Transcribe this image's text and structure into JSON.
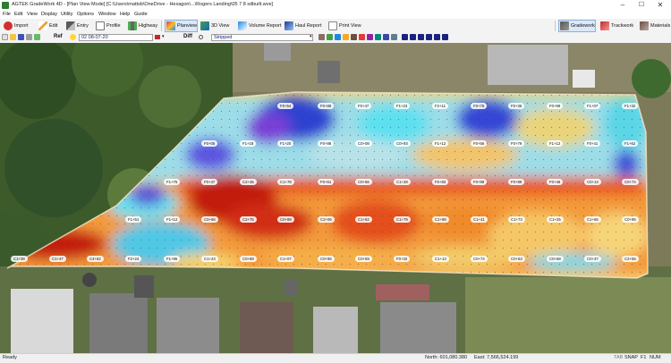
{
  "window": {
    "title": "AGTEK GradeWork 4D - [Plan View Mode] [C:\\Users\\mattsb\\OneDrive - Hexagon\\...\\Rogers Landing\\05 7 8 sdbuilt.wve]",
    "controls": [
      "–",
      "☐",
      "✕"
    ]
  },
  "menu": [
    "File",
    "Edit",
    "View",
    "Display",
    "Utility",
    "Options",
    "Window",
    "Help",
    "Guide"
  ],
  "toolbar": {
    "import": "Import",
    "edit": "Edit",
    "entry": "Entry",
    "profile": "Profile",
    "highway": "Highway",
    "planview": "Planview",
    "view3d": "3D View",
    "volume_report": "Volume Report",
    "haul_report": "Haul Report",
    "print_view": "Print View",
    "gradework": "Gradework",
    "trackwork": "Trackwork",
    "materials": "Materials"
  },
  "refbar": {
    "ref_label": "Ref",
    "ref_value": "02 08-07-20",
    "diff_label": "Diff",
    "diff_value": "Stripped"
  },
  "stations": {
    "row1": [
      "F0+54",
      "F0+88",
      "F0+47",
      "F1+23",
      "F2+11",
      "F0+75",
      "F0+36",
      "F0+99",
      "F1+07",
      "F1+32"
    ],
    "row2": [
      "F0+05",
      "F1+18",
      "F1+20",
      "F0+88",
      "C0+08",
      "C0+93",
      "F1+12",
      "F0+56",
      "F0+79",
      "F1+12",
      "F0+41",
      "F1+62"
    ],
    "row3": [
      "F1+76",
      "F0+47",
      "C2+35",
      "C1+78",
      "F0+61",
      "C0+56",
      "C1+28",
      "F0+83",
      "F0+99",
      "F0+89",
      "F0+46",
      "C0+14",
      "C0+74"
    ],
    "row4": [
      "F1+51",
      "F1+12",
      "C0+66",
      "C2+75",
      "C0+88",
      "C2+06",
      "C1+62",
      "C1+79",
      "C1+88",
      "C1+41",
      "C1+73",
      "C1+25",
      "C1+66",
      "C0+95"
    ],
    "row5": [
      "C1+38",
      "C1+47",
      "C4+62",
      "F2+24",
      "F1+95",
      "C1+23",
      "C0+89",
      "C1+07",
      "C0+96",
      "C0+59",
      "F0+32",
      "C1+13",
      "C0+74",
      "C0+63",
      "C0+68",
      "C0+37",
      "C2+55"
    ]
  },
  "status": {
    "ready": "Ready",
    "north": "North: 601,080.380",
    "east": "East: 7,566,524.199",
    "indicators": [
      "TAB",
      "SNAP",
      "F1",
      "NUM"
    ]
  },
  "colors": {
    "cut_red": "#c0180f",
    "cut_orange": "#f07a1e",
    "neutral_yellow": "#f6d66a",
    "fill_cyan": "#55d6e8",
    "fill_blue": "#2b3fcf",
    "fill_purple": "#8a3fd0"
  }
}
